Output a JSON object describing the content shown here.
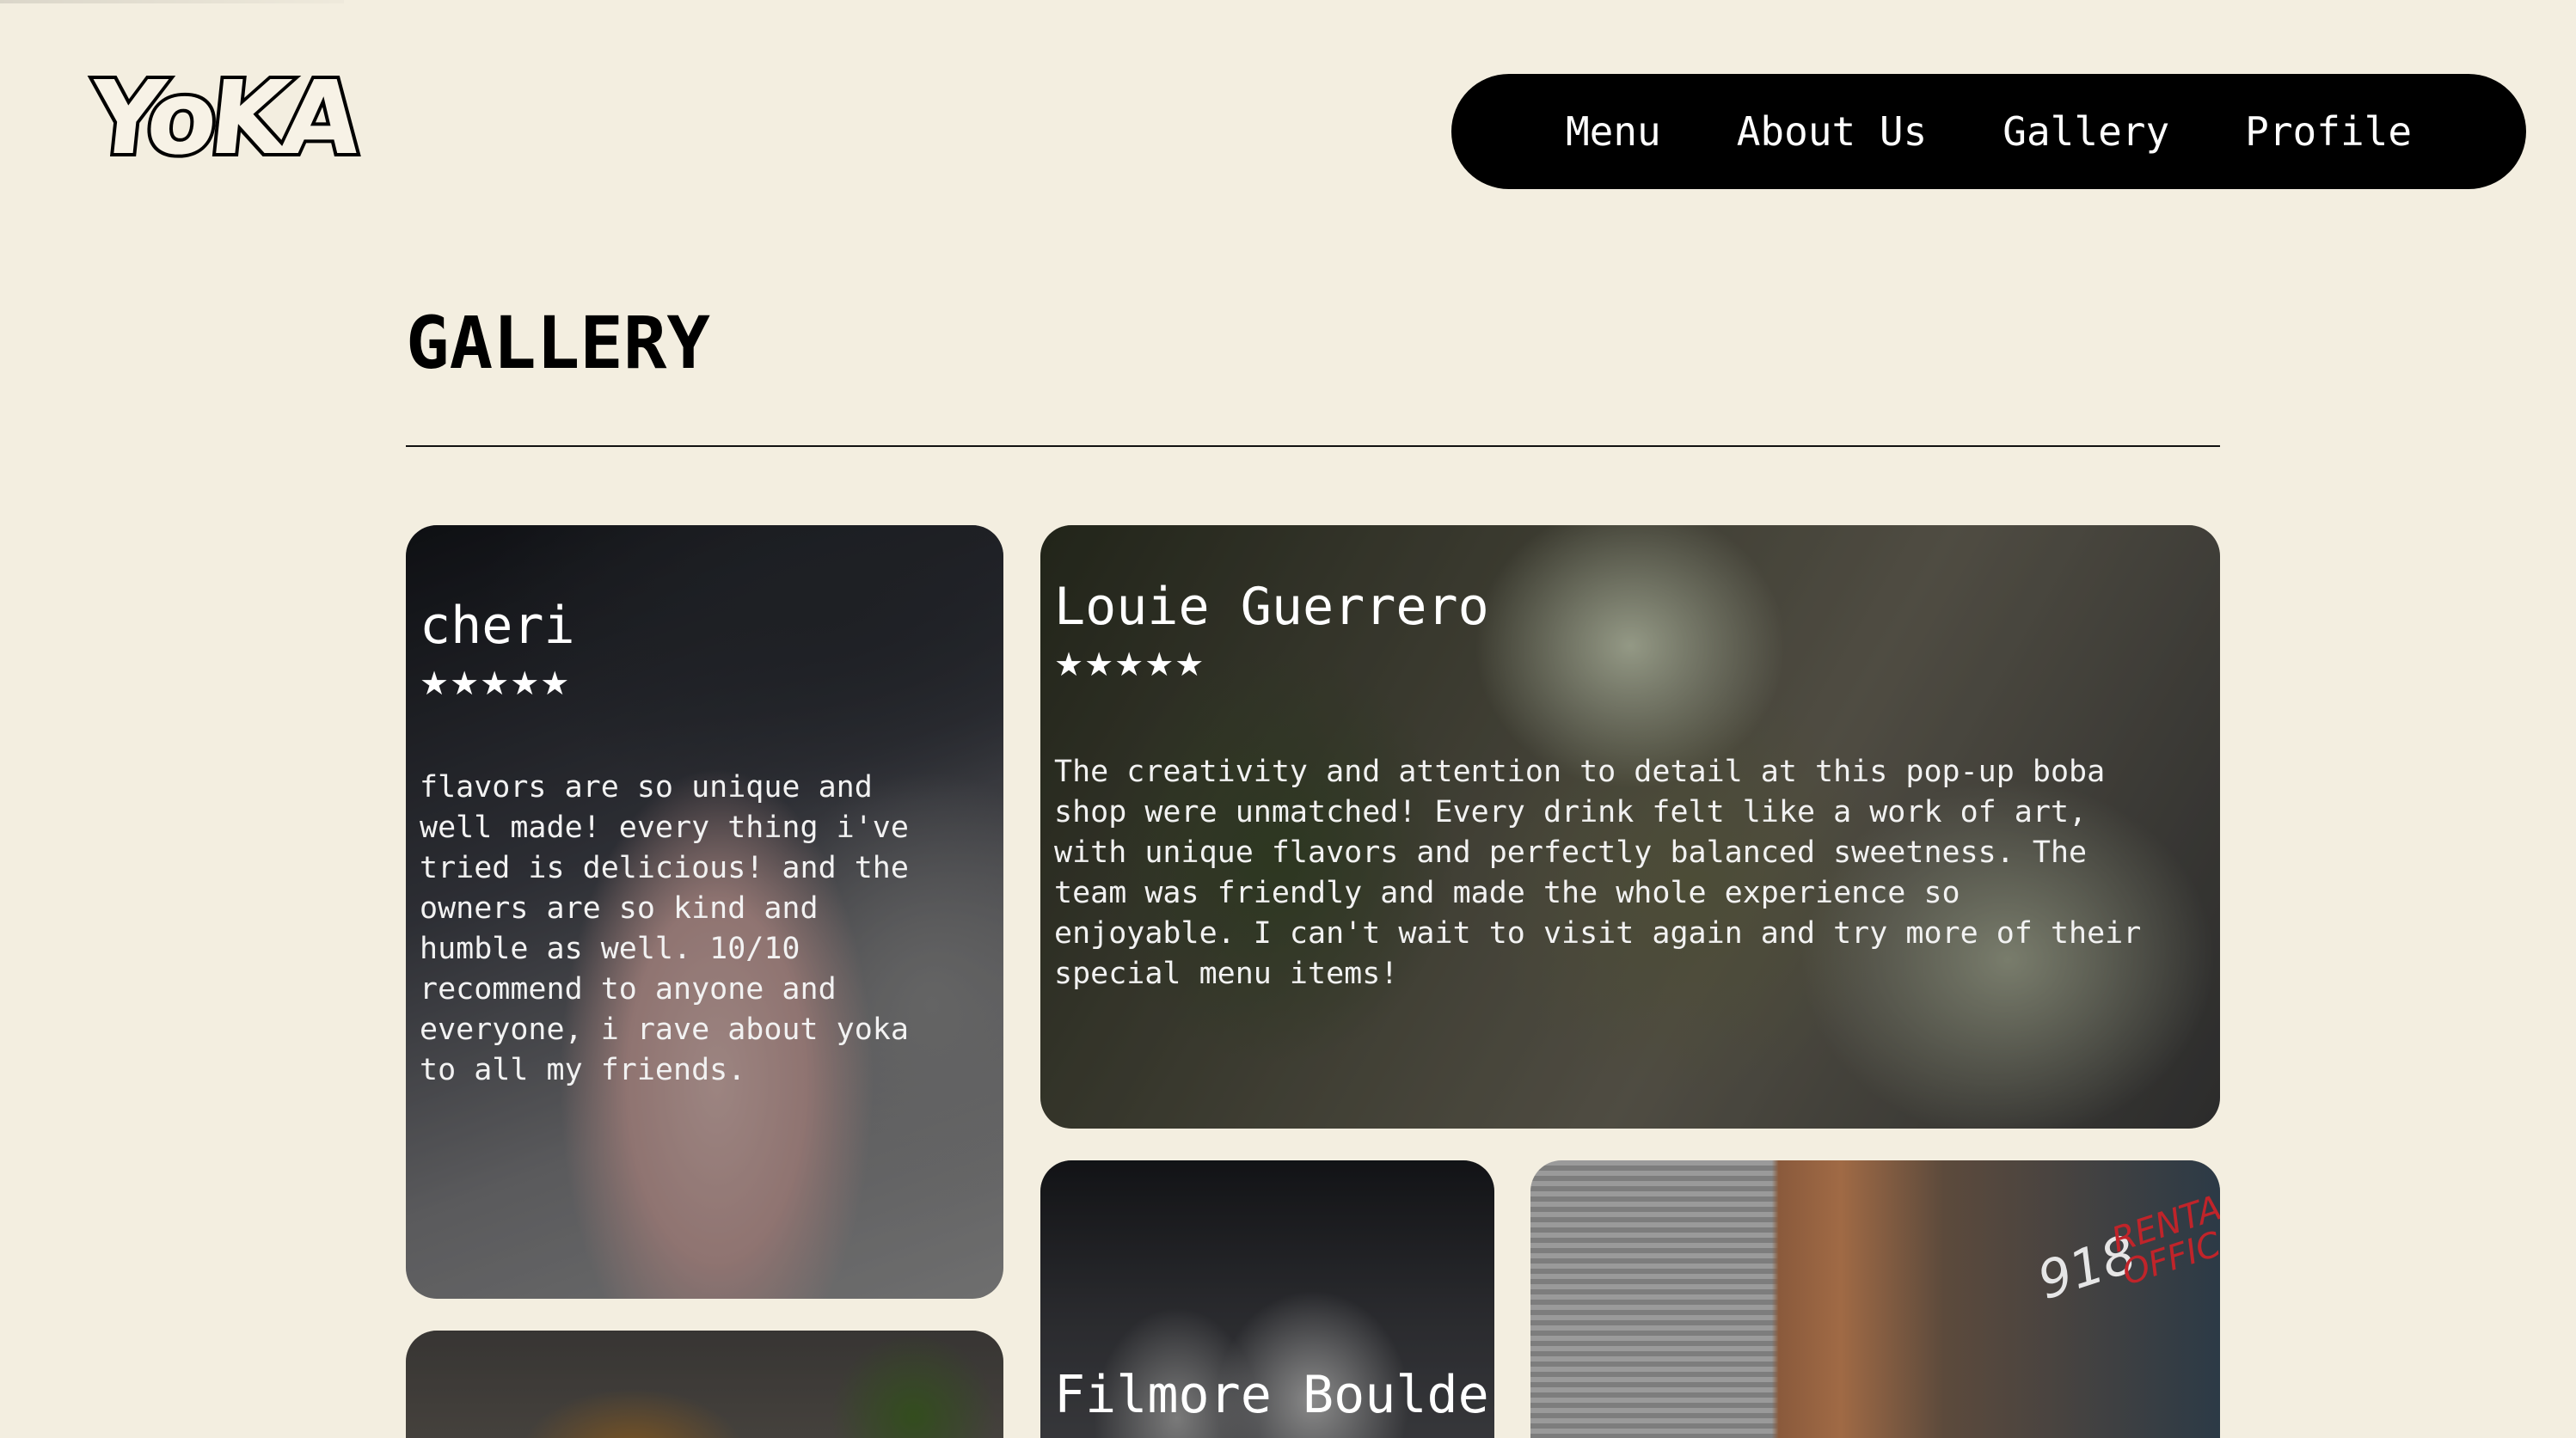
{
  "brand": {
    "logo_text": "YoKA"
  },
  "nav": {
    "items": [
      {
        "label": "Menu"
      },
      {
        "label": "About Us"
      },
      {
        "label": "Gallery"
      },
      {
        "label": "Profile"
      }
    ]
  },
  "page": {
    "title": "GALLERY"
  },
  "reviews": [
    {
      "name": "cheri",
      "stars": "★★★★★",
      "rating": 5,
      "text": "flavors are so unique and\nwell made! every thing i've\ntried is delicious! and the\nowners are so kind and\nhumble as well. 10/10\nrecommend to anyone and\neveryone, i rave about yoka\nto all my friends."
    },
    {
      "name": "Louie Guerrero",
      "stars": "★★★★★",
      "rating": 5,
      "text": "The creativity and attention to detail at this pop-up boba\nshop were unmatched! Every drink felt like a work of art,\nwith unique flavors and perfectly balanced sweetness. The\nteam was friendly and made the whole experience so\nenjoyable. I can't wait to visit again and try more of their\nspecial menu items!"
    },
    {
      "name": "Filmore Bouldes"
    }
  ],
  "storefront": {
    "number": "918",
    "sign": "RENTAL\nOFFICE"
  }
}
